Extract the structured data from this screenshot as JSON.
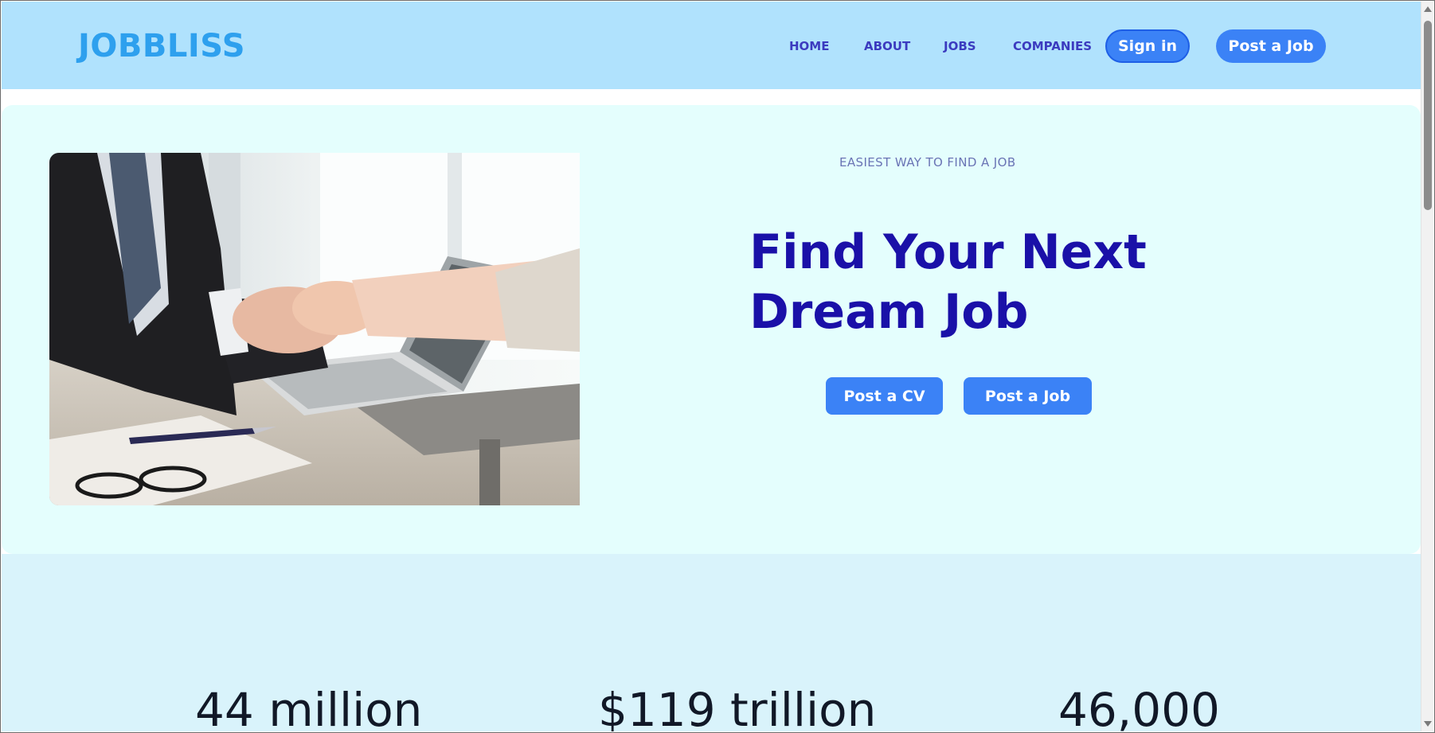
{
  "header": {
    "logo": "JOBBLISS",
    "nav": [
      {
        "label": "HOME"
      },
      {
        "label": "ABOUT"
      },
      {
        "label": "JOBS"
      },
      {
        "label": "COMPANIES"
      }
    ],
    "signin_label": "Sign in",
    "post_job_label": "Post a Job"
  },
  "hero": {
    "eyebrow": "EASIEST WAY TO FIND A JOB",
    "headline": "Find Your Next Dream Job",
    "cta_cv": "Post a CV",
    "cta_job": "Post a Job"
  },
  "stats": [
    {
      "value": "44 million"
    },
    {
      "value": "$119 trillion"
    },
    {
      "value": "46,000"
    }
  ],
  "colors": {
    "header_bg": "#b0e2fd",
    "logo": "#2ea0ee",
    "nav": "#3b3bbf",
    "button": "#3b82f6",
    "hero_bg": "#e4fefd",
    "headline": "#1a10a8",
    "stats_bg": "#d9f3fb"
  }
}
